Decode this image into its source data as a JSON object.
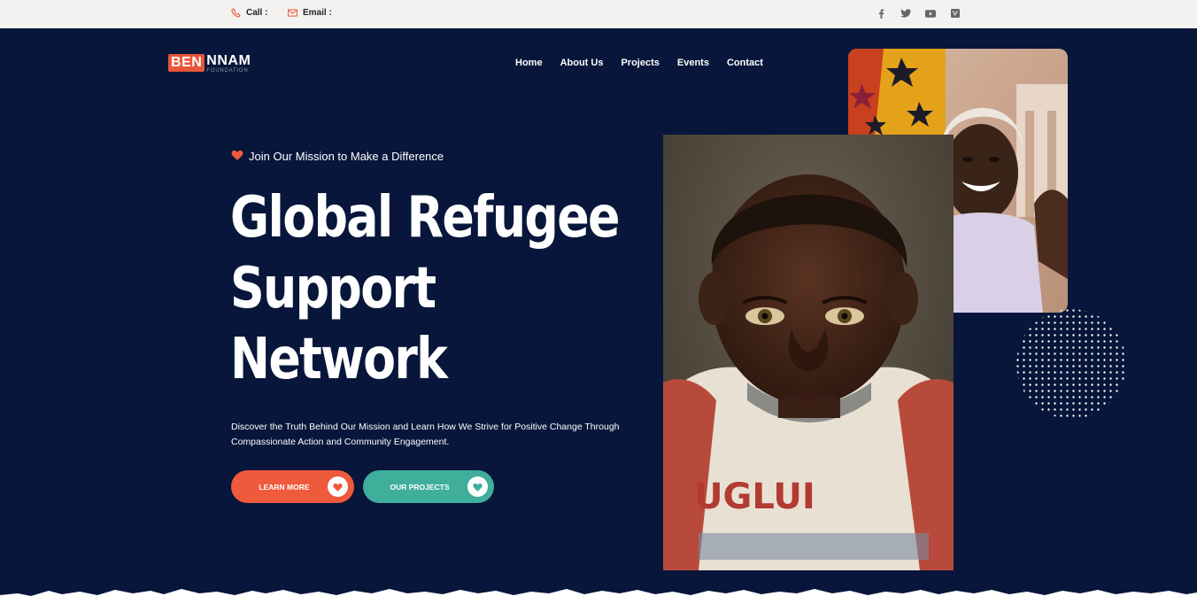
{
  "topbar": {
    "call_label": "Call :",
    "email_label": "Email :",
    "social_icons": [
      "facebook-icon",
      "twitter-icon",
      "youtube-icon",
      "vimeo-icon"
    ]
  },
  "logo": {
    "ben": "BEN",
    "nnam": "NNAM",
    "foundation": "FOUNDATION"
  },
  "nav": {
    "items": [
      "Home",
      "About Us",
      "Projects",
      "Events",
      "Contact"
    ]
  },
  "hero": {
    "tagline": "Join Our Mission to Make a Difference",
    "title_line1": "Global Refugee",
    "title_line2": "Support",
    "title_line3": "Network",
    "description": "Discover the Truth Behind Our Mission and Learn How We Strive for Positive Change Through Compassionate Action and Community Engagement.",
    "btn_learn": "LEARN MORE",
    "btn_projects": "OUR PROJECTS"
  },
  "colors": {
    "background": "#07163a",
    "accent_orange": "#ef5a3c",
    "accent_teal": "#3fae9b",
    "topbar": "#f3f2f0"
  }
}
